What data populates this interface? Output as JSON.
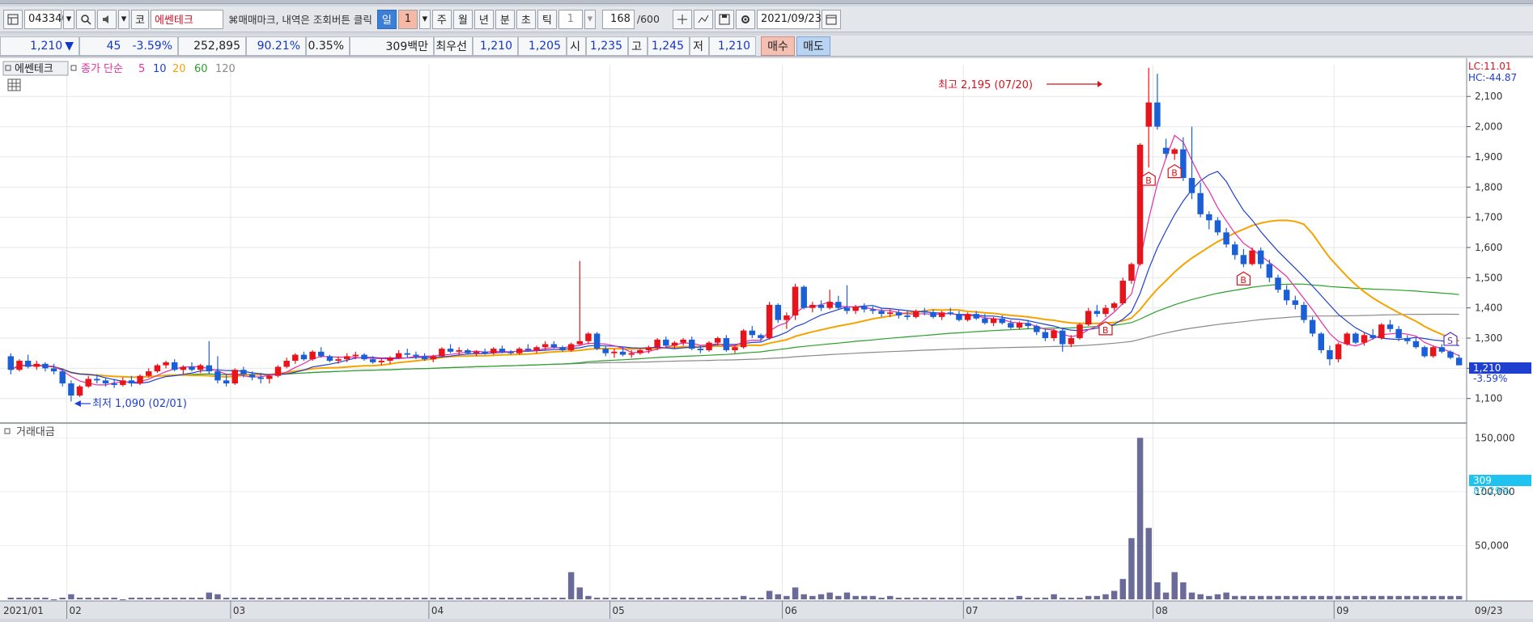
{
  "toolbar": {
    "code": "043340",
    "market_icon": "코",
    "stock_name": "에쎈테크",
    "notice": "⌘매매마크, 내역은 조회버튼 클릭",
    "periods": [
      "일",
      "1",
      "주",
      "월",
      "년",
      "분",
      "초",
      "틱"
    ],
    "tick_value": "1",
    "count": "168",
    "count_max": "/600",
    "date": "2021/09/23"
  },
  "quote": {
    "price": "1,210",
    "change_arrow": "▼",
    "change": "45",
    "change_rate": "-3.59%",
    "volume": "252,895",
    "volume_ratio": "90.21%",
    "turnover_rate": "0.35%",
    "amount": "309백만",
    "best_label": "최우선",
    "best_ask": "1,210",
    "best_bid": "1,205",
    "open_label": "시",
    "open": "1,235",
    "high_label": "고",
    "high": "1,245",
    "low_label": "저",
    "low": "1,210",
    "buy_label": "매수",
    "sell_label": "매도"
  },
  "legend": {
    "stock": "에쎈테크",
    "ma_label": "종가 단순",
    "ma5": "5",
    "ma10": "10",
    "ma20": "20",
    "ma60": "60",
    "ma120": "120"
  },
  "annotations": {
    "high": "최고 2,195 (07/20)",
    "low": "최저 1,090 (02/01)",
    "lc": "LC:11.01",
    "hc": "HC:-44.87",
    "current_price": "1,210",
    "current_rate": "-3.59%",
    "vol_current": "309",
    "vol_rate": "87.29%",
    "volume_panel": "거래대금"
  },
  "colors": {
    "up": "#e8141b",
    "down": "#1b5fd6",
    "ma5": "#e62da6",
    "ma10": "#1f3fd0",
    "ma20": "#f5a300",
    "ma60": "#2aa02a",
    "ma120": "#8a8a8a"
  },
  "chart_data": {
    "type": "candlestick",
    "y_ticks": [
      "2,100",
      "2,000",
      "1,900",
      "1,800",
      "1,700",
      "1,600",
      "1,500",
      "1,400",
      "1,300",
      "1,200",
      "1,100"
    ],
    "ylim": [
      1035,
      2205
    ],
    "vol_ticks": [
      "150,000",
      "100,000",
      "50,000"
    ],
    "vol_max": 160000,
    "x_labels": [
      "2021/01",
      "02",
      "03",
      "04",
      "05",
      "06",
      "07",
      "08",
      "09",
      "09/23"
    ],
    "candles": [
      [
        1240,
        1250,
        1180,
        1195
      ],
      [
        1195,
        1230,
        1190,
        1225
      ],
      [
        1225,
        1245,
        1200,
        1205
      ],
      [
        1205,
        1225,
        1195,
        1215
      ],
      [
        1215,
        1220,
        1190,
        1200
      ],
      [
        1200,
        1215,
        1180,
        1190
      ],
      [
        1190,
        1200,
        1140,
        1150
      ],
      [
        1150,
        1160,
        1090,
        1110
      ],
      [
        1110,
        1145,
        1105,
        1140
      ],
      [
        1140,
        1175,
        1135,
        1165
      ],
      [
        1165,
        1180,
        1150,
        1160
      ],
      [
        1160,
        1170,
        1140,
        1150
      ],
      [
        1150,
        1165,
        1135,
        1145
      ],
      [
        1145,
        1170,
        1140,
        1160
      ],
      [
        1160,
        1175,
        1140,
        1150
      ],
      [
        1150,
        1180,
        1145,
        1175
      ],
      [
        1175,
        1200,
        1170,
        1190
      ],
      [
        1190,
        1215,
        1185,
        1210
      ],
      [
        1210,
        1225,
        1200,
        1220
      ],
      [
        1220,
        1230,
        1190,
        1195
      ],
      [
        1195,
        1210,
        1180,
        1205
      ],
      [
        1205,
        1220,
        1190,
        1195
      ],
      [
        1195,
        1215,
        1185,
        1210
      ],
      [
        1210,
        1290,
        1180,
        1190
      ],
      [
        1190,
        1240,
        1150,
        1160
      ],
      [
        1160,
        1180,
        1140,
        1150
      ],
      [
        1150,
        1200,
        1145,
        1195
      ],
      [
        1195,
        1205,
        1170,
        1180
      ],
      [
        1180,
        1190,
        1160,
        1170
      ],
      [
        1170,
        1185,
        1150,
        1165
      ],
      [
        1165,
        1180,
        1150,
        1175
      ],
      [
        1175,
        1210,
        1170,
        1205
      ],
      [
        1205,
        1235,
        1200,
        1225
      ],
      [
        1225,
        1250,
        1215,
        1245
      ],
      [
        1245,
        1255,
        1225,
        1230
      ],
      [
        1230,
        1260,
        1225,
        1255
      ],
      [
        1255,
        1270,
        1235,
        1240
      ],
      [
        1240,
        1245,
        1220,
        1225
      ],
      [
        1225,
        1240,
        1215,
        1230
      ],
      [
        1230,
        1250,
        1220,
        1240
      ],
      [
        1240,
        1255,
        1230,
        1245
      ],
      [
        1245,
        1250,
        1225,
        1230
      ],
      [
        1230,
        1240,
        1215,
        1220
      ],
      [
        1220,
        1235,
        1210,
        1225
      ],
      [
        1225,
        1240,
        1215,
        1235
      ],
      [
        1235,
        1260,
        1230,
        1250
      ],
      [
        1250,
        1265,
        1235,
        1245
      ],
      [
        1245,
        1255,
        1230,
        1240
      ],
      [
        1240,
        1250,
        1225,
        1230
      ],
      [
        1230,
        1245,
        1220,
        1240
      ],
      [
        1240,
        1270,
        1235,
        1265
      ],
      [
        1265,
        1280,
        1250,
        1255
      ],
      [
        1255,
        1270,
        1245,
        1260
      ],
      [
        1260,
        1265,
        1245,
        1250
      ],
      [
        1250,
        1260,
        1240,
        1255
      ],
      [
        1255,
        1265,
        1245,
        1250
      ],
      [
        1250,
        1270,
        1245,
        1265
      ],
      [
        1265,
        1275,
        1250,
        1255
      ],
      [
        1255,
        1260,
        1245,
        1250
      ],
      [
        1250,
        1270,
        1245,
        1265
      ],
      [
        1265,
        1280,
        1255,
        1260
      ],
      [
        1260,
        1275,
        1250,
        1270
      ],
      [
        1270,
        1290,
        1260,
        1280
      ],
      [
        1280,
        1290,
        1265,
        1270
      ],
      [
        1270,
        1275,
        1255,
        1260
      ],
      [
        1260,
        1285,
        1255,
        1280
      ],
      [
        1280,
        1555,
        1275,
        1290
      ],
      [
        1290,
        1320,
        1280,
        1315
      ],
      [
        1315,
        1320,
        1260,
        1265
      ],
      [
        1265,
        1275,
        1240,
        1250
      ],
      [
        1250,
        1265,
        1235,
        1255
      ],
      [
        1255,
        1270,
        1240,
        1245
      ],
      [
        1245,
        1260,
        1235,
        1250
      ],
      [
        1250,
        1265,
        1245,
        1260
      ],
      [
        1260,
        1275,
        1250,
        1270
      ],
      [
        1270,
        1300,
        1260,
        1295
      ],
      [
        1295,
        1305,
        1270,
        1275
      ],
      [
        1275,
        1290,
        1265,
        1285
      ],
      [
        1285,
        1300,
        1275,
        1295
      ],
      [
        1295,
        1305,
        1260,
        1265
      ],
      [
        1265,
        1275,
        1250,
        1260
      ],
      [
        1260,
        1290,
        1255,
        1285
      ],
      [
        1285,
        1305,
        1275,
        1300
      ],
      [
        1300,
        1310,
        1255,
        1260
      ],
      [
        1260,
        1275,
        1250,
        1270
      ],
      [
        1270,
        1330,
        1265,
        1325
      ],
      [
        1325,
        1340,
        1300,
        1310
      ],
      [
        1310,
        1315,
        1290,
        1300
      ],
      [
        1300,
        1420,
        1295,
        1410
      ],
      [
        1410,
        1415,
        1350,
        1360
      ],
      [
        1360,
        1385,
        1330,
        1375
      ],
      [
        1375,
        1480,
        1360,
        1470
      ],
      [
        1470,
        1475,
        1395,
        1400
      ],
      [
        1400,
        1420,
        1385,
        1410
      ],
      [
        1410,
        1425,
        1390,
        1400
      ],
      [
        1400,
        1460,
        1395,
        1420
      ],
      [
        1420,
        1440,
        1395,
        1400
      ],
      [
        1400,
        1475,
        1380,
        1390
      ],
      [
        1390,
        1410,
        1380,
        1405
      ],
      [
        1405,
        1415,
        1385,
        1395
      ],
      [
        1395,
        1405,
        1380,
        1390
      ],
      [
        1390,
        1400,
        1370,
        1380
      ],
      [
        1380,
        1395,
        1370,
        1385
      ],
      [
        1385,
        1395,
        1365,
        1375
      ],
      [
        1375,
        1390,
        1360,
        1370
      ],
      [
        1370,
        1395,
        1365,
        1390
      ],
      [
        1390,
        1400,
        1375,
        1385
      ],
      [
        1385,
        1395,
        1365,
        1370
      ],
      [
        1370,
        1390,
        1360,
        1385
      ],
      [
        1385,
        1400,
        1375,
        1380
      ],
      [
        1380,
        1390,
        1355,
        1360
      ],
      [
        1360,
        1385,
        1355,
        1380
      ],
      [
        1380,
        1390,
        1360,
        1365
      ],
      [
        1365,
        1380,
        1345,
        1350
      ],
      [
        1350,
        1370,
        1340,
        1365
      ],
      [
        1365,
        1375,
        1345,
        1350
      ],
      [
        1350,
        1360,
        1330,
        1335
      ],
      [
        1335,
        1355,
        1330,
        1350
      ],
      [
        1350,
        1360,
        1330,
        1340
      ],
      [
        1340,
        1345,
        1310,
        1320
      ],
      [
        1320,
        1330,
        1290,
        1300
      ],
      [
        1300,
        1330,
        1290,
        1325
      ],
      [
        1325,
        1335,
        1255,
        1280
      ],
      [
        1280,
        1310,
        1270,
        1300
      ],
      [
        1300,
        1350,
        1295,
        1345
      ],
      [
        1345,
        1400,
        1340,
        1390
      ],
      [
        1390,
        1410,
        1370,
        1380
      ],
      [
        1380,
        1410,
        1370,
        1400
      ],
      [
        1400,
        1420,
        1390,
        1415
      ],
      [
        1415,
        1500,
        1410,
        1490
      ],
      [
        1490,
        1550,
        1480,
        1545
      ],
      [
        1545,
        1945,
        1540,
        1940
      ],
      [
        2000,
        2195,
        1865,
        2080
      ],
      [
        2080,
        2175,
        1990,
        2000
      ],
      [
        1930,
        1960,
        1895,
        1910
      ],
      [
        1910,
        1930,
        1890,
        1925
      ],
      [
        1925,
        1965,
        1820,
        1830
      ],
      [
        1830,
        2000,
        1760,
        1780
      ],
      [
        1780,
        1815,
        1700,
        1710
      ],
      [
        1710,
        1720,
        1660,
        1690
      ],
      [
        1690,
        1700,
        1640,
        1650
      ],
      [
        1650,
        1665,
        1600,
        1610
      ],
      [
        1610,
        1620,
        1560,
        1575
      ],
      [
        1575,
        1595,
        1535,
        1545
      ],
      [
        1545,
        1600,
        1540,
        1590
      ],
      [
        1590,
        1600,
        1530,
        1545
      ],
      [
        1545,
        1560,
        1485,
        1500
      ],
      [
        1500,
        1510,
        1450,
        1460
      ],
      [
        1460,
        1475,
        1410,
        1425
      ],
      [
        1425,
        1440,
        1395,
        1410
      ],
      [
        1410,
        1420,
        1350,
        1360
      ],
      [
        1360,
        1370,
        1305,
        1315
      ],
      [
        1315,
        1320,
        1250,
        1260
      ],
      [
        1260,
        1275,
        1210,
        1230
      ],
      [
        1230,
        1285,
        1220,
        1280
      ],
      [
        1280,
        1320,
        1275,
        1315
      ],
      [
        1315,
        1320,
        1280,
        1285
      ],
      [
        1285,
        1320,
        1275,
        1310
      ],
      [
        1310,
        1330,
        1295,
        1300
      ],
      [
        1300,
        1350,
        1295,
        1345
      ],
      [
        1345,
        1360,
        1320,
        1330
      ],
      [
        1330,
        1340,
        1290,
        1300
      ],
      [
        1300,
        1310,
        1280,
        1290
      ],
      [
        1290,
        1300,
        1265,
        1270
      ],
      [
        1270,
        1275,
        1235,
        1240
      ],
      [
        1240,
        1275,
        1235,
        1270
      ],
      [
        1270,
        1280,
        1250,
        1255
      ],
      [
        1255,
        1260,
        1230,
        1235
      ],
      [
        1235,
        1245,
        1210,
        1210
      ]
    ],
    "volume": [
      1,
      1,
      1,
      1,
      1,
      0,
      1,
      3,
      1,
      1,
      1,
      1,
      1,
      0,
      1,
      1,
      1,
      1,
      1,
      1,
      1,
      1,
      1,
      4,
      3,
      1,
      1,
      1,
      1,
      1,
      1,
      1,
      1,
      1,
      1,
      1,
      1,
      1,
      1,
      1,
      1,
      1,
      1,
      1,
      1,
      1,
      1,
      1,
      1,
      1,
      1,
      1,
      1,
      1,
      1,
      1,
      1,
      1,
      1,
      1,
      1,
      1,
      1,
      1,
      1,
      16,
      7,
      2,
      1,
      1,
      1,
      1,
      1,
      1,
      1,
      1,
      1,
      1,
      1,
      1,
      1,
      1,
      1,
      1,
      1,
      2,
      1,
      1,
      5,
      3,
      2,
      7,
      3,
      2,
      3,
      4,
      2,
      4,
      2,
      2,
      2,
      1,
      2,
      1,
      1,
      1,
      1,
      1,
      1,
      1,
      1,
      1,
      1,
      1,
      1,
      1,
      1,
      2,
      1,
      1,
      1,
      3,
      1,
      1,
      1,
      2,
      2,
      3,
      5,
      12,
      36,
      95,
      42,
      10,
      4,
      16,
      10,
      4,
      3,
      2,
      3,
      4,
      2,
      2,
      2,
      2,
      2,
      2,
      2,
      2,
      2,
      2,
      2,
      2,
      2,
      2,
      2,
      2,
      2,
      2,
      2,
      2,
      2,
      2,
      2,
      2,
      2,
      2,
      2
    ],
    "ma_series": {
      "ma5": [],
      "ma10": [],
      "ma20": [],
      "ma60": [],
      "ma120": []
    },
    "markers": [
      {
        "type": "B",
        "index": 127
      },
      {
        "type": "B",
        "index": 132
      },
      {
        "type": "B",
        "index": 135
      },
      {
        "type": "B",
        "index": 143
      },
      {
        "type": "S",
        "index": 167
      }
    ]
  }
}
